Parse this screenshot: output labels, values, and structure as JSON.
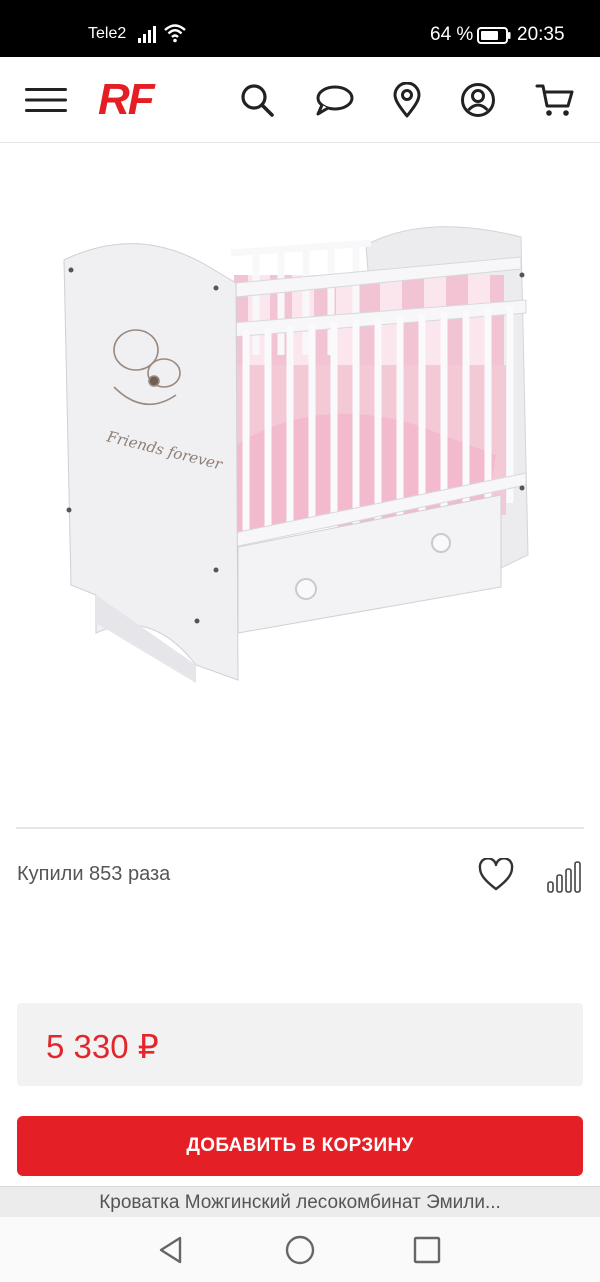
{
  "status_bar": {
    "carrier": "Tele2",
    "battery": "64 %",
    "time": "20:35",
    "icons": [
      "signal-icon",
      "wifi-icon",
      "battery-icon"
    ]
  },
  "header": {
    "logo": "RF",
    "icons": [
      "menu-icon",
      "search-icon",
      "chat-icon",
      "location-pin-icon",
      "account-icon",
      "cart-icon"
    ]
  },
  "product": {
    "image_alt": "Кроватка детская белая Friends forever",
    "image_text": "Friends forever",
    "bought": "Купили 853 раза",
    "price": "5 330 ₽",
    "add_to_cart": "ДОБАВИТЬ В КОРЗИНУ",
    "action_icons": [
      "heart-icon",
      "compare-bars-icon"
    ]
  },
  "tab": {
    "title": "Кроватка Можгинский лесокомбинат Эмили..."
  },
  "nav": {
    "icons": [
      "back-triangle-icon",
      "home-circle-icon",
      "recents-square-icon"
    ]
  },
  "colors": {
    "brand": "#e51e25",
    "price": "#e3262c",
    "button": "#e41f26"
  }
}
